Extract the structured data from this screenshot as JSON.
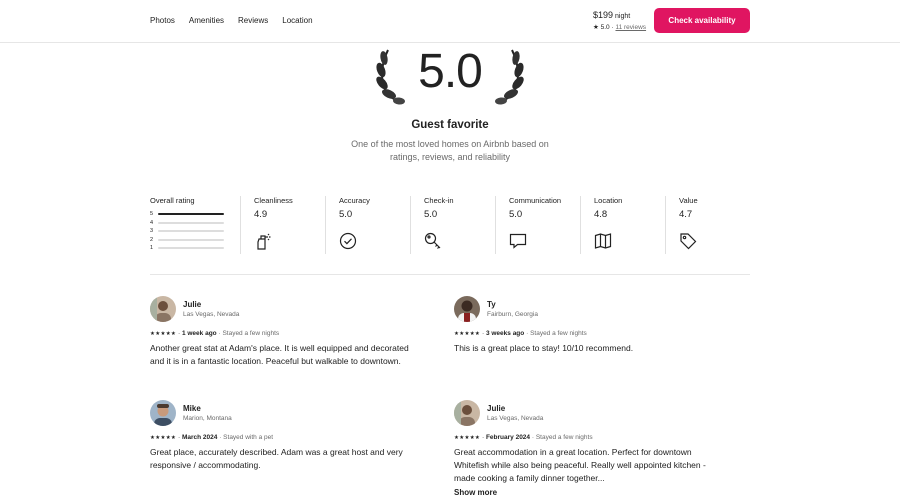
{
  "header": {
    "nav": [
      "Photos",
      "Amenities",
      "Reviews",
      "Location"
    ],
    "price": "$199",
    "price_unit": "night",
    "rating": "★ 5.0",
    "sep": "·",
    "reviews_link": "11 reviews",
    "cta": "Check availability"
  },
  "hero": {
    "score": "5.0",
    "title": "Guest favorite",
    "subtitle": "One of the most loved homes on Airbnb based on ratings, reviews, and reliability"
  },
  "overall": {
    "label": "Overall rating",
    "bars": [
      {
        "star": "5",
        "fraction": 1.0
      },
      {
        "star": "4",
        "fraction": 0.0
      },
      {
        "star": "3",
        "fraction": 0.0
      },
      {
        "star": "2",
        "fraction": 0.0
      },
      {
        "star": "1",
        "fraction": 0.0
      }
    ]
  },
  "categories": [
    {
      "name": "Cleanliness",
      "value": "4.9",
      "icon": "spray-bottle-icon"
    },
    {
      "name": "Accuracy",
      "value": "5.0",
      "icon": "check-circle-icon"
    },
    {
      "name": "Check-in",
      "value": "5.0",
      "icon": "key-icon"
    },
    {
      "name": "Communication",
      "value": "5.0",
      "icon": "chat-bubble-icon"
    },
    {
      "name": "Location",
      "value": "4.8",
      "icon": "map-icon"
    },
    {
      "name": "Value",
      "value": "4.7",
      "icon": "price-tag-icon"
    }
  ],
  "reviews": [
    {
      "name": "Julie",
      "location": "Las Vegas, Nevada",
      "stars": "★★★★★",
      "when": "1 week ago",
      "stay": "Stayed a few nights",
      "text": "Another great stat at Adam's place. It is well equipped and decorated and it is in a fantastic location. Peaceful but walkable to downtown."
    },
    {
      "name": "Ty",
      "location": "Fairburn, Georgia",
      "stars": "★★★★★",
      "when": "3 weeks ago",
      "stay": "Stayed a few nights",
      "text": "This is a great place to stay! 10/10 recommend."
    },
    {
      "name": "Mike",
      "location": "Marion, Montana",
      "stars": "★★★★★",
      "when": "March 2024",
      "stay": "Stayed with a pet",
      "text": "Great place, accurately described. Adam was a great host and very responsive / accommodating."
    },
    {
      "name": "Julie",
      "location": "Las Vegas, Nevada",
      "stars": "★★★★★",
      "when": "February 2024",
      "stay": "Stayed a few nights",
      "text": "Great accommodation in a great location. Perfect for downtown Whitefish while also being peaceful. Really well appointed kitchen - made cooking a family dinner together..."
    }
  ],
  "show_more": "Show more",
  "dot": "·",
  "colors": {
    "accent": "#e01561",
    "text": "#222222",
    "muted": "#6a6a6a"
  }
}
